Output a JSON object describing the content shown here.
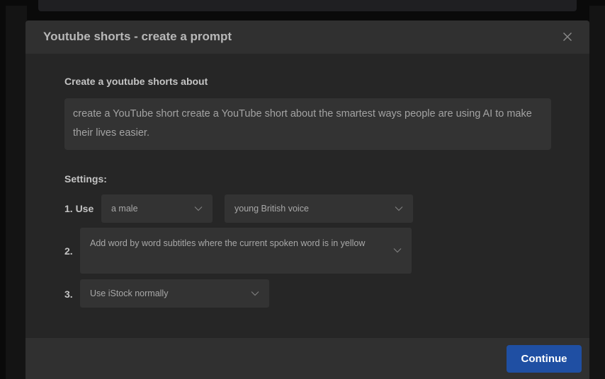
{
  "modal": {
    "title": "Youtube shorts - create a prompt"
  },
  "prompt": {
    "label": "Create a youtube shorts about",
    "text": "create a YouTube short create a YouTube short about the smartest ways people are using AI to make their lives easier."
  },
  "settings": {
    "label": "Settings:",
    "row1": {
      "number": "1. Use",
      "select_a": "a male",
      "select_b": "young British voice"
    },
    "row2": {
      "number": "2.",
      "select": "Add word by word subtitles where the current spoken word is in yellow"
    },
    "row3": {
      "number": "3.",
      "select": "Use iStock normally"
    }
  },
  "footer": {
    "continue_label": "Continue"
  },
  "colors": {
    "primary_button": "#1f4fa3",
    "modal_bg": "#262626",
    "header_bg": "#303030",
    "field_bg": "#333333"
  },
  "icons": {
    "close": "close-icon",
    "dropdown": "chevron-down-icon"
  }
}
